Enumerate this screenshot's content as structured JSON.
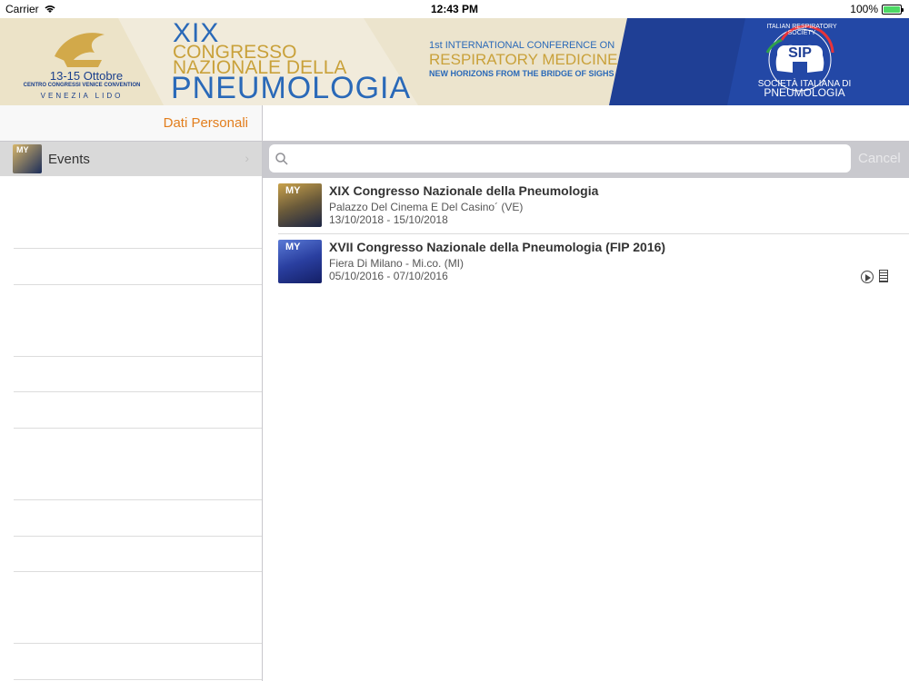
{
  "status": {
    "carrier": "Carrier",
    "time": "12:43 PM",
    "battery": "100%"
  },
  "banner": {
    "date": "13-15 Ottobre",
    "venue": "CENTRO CONGRESSI VENICE CONVENTION",
    "lido": "VENEZIA LIDO",
    "line1": "XIX",
    "line2": "CONGRESSO",
    "line3": "NAZIONALE DELLA",
    "line4": "PNEUMOLOGIA",
    "intl": "1st INTERNATIONAL CONFERENCE ON",
    "resp": "RESPIRATORY MEDICINE",
    "bridge": "NEW HORIZONS FROM THE BRIDGE OF SIGHS",
    "society_arc": "ITALIAN RESPIRATORY SOCIETY",
    "sip": "SIP",
    "soc": "SOCIETÀ ITALIANA DI",
    "soc2": "PNEUMOLOGIA"
  },
  "nav": {
    "left_title": "Dati Personali"
  },
  "sidebar": {
    "items": [
      {
        "label": "Events",
        "thumb": "MY"
      }
    ]
  },
  "search": {
    "placeholder": "",
    "cancel": "Cancel"
  },
  "events": [
    {
      "title": "XIX Congresso Nazionale della Pneumologia",
      "location": "Palazzo Del Cinema E Del Casino´ (VE)",
      "dates": "13/10/2018 - 15/10/2018",
      "thumb": "MY"
    },
    {
      "title": "XVII Congresso Nazionale della Pneumologia (FIP 2016)",
      "location": "Fiera Di Milano - Mi.co. (MI)",
      "dates": "05/10/2016 - 07/10/2016",
      "thumb": "MY"
    }
  ],
  "colors": {
    "accent": "#e27d1c",
    "blue": "#2a69b8",
    "gold": "#c9a13a"
  }
}
